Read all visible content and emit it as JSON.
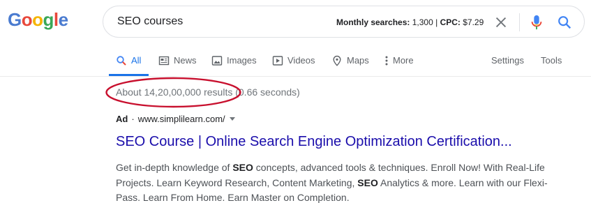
{
  "logo": {
    "letters": [
      "G",
      "o",
      "o",
      "g",
      "l",
      "e"
    ]
  },
  "search": {
    "query": "SEO courses",
    "metrics_label_1": "Monthly searches:",
    "metrics_value_1": "1,300",
    "metrics_sep": "|",
    "metrics_label_2": "CPC:",
    "metrics_value_2": "$7.29"
  },
  "tabs": [
    {
      "label": "All",
      "icon": "search-icon",
      "active": true
    },
    {
      "label": "News",
      "icon": "newspaper-icon"
    },
    {
      "label": "Images",
      "icon": "image-icon"
    },
    {
      "label": "Videos",
      "icon": "video-icon"
    },
    {
      "label": "Maps",
      "icon": "map-pin-icon"
    },
    {
      "label": "More",
      "icon": "more-vert-icon"
    }
  ],
  "tools": {
    "settings_label": "Settings",
    "tools_label": "Tools"
  },
  "results_stats": "About 14,20,00,000 results (0.66 seconds)",
  "ad": {
    "badge": "Ad",
    "dot": "·",
    "url": "www.simplilearn.com/",
    "title": "SEO Course | Online Search Engine Optimization Certification...",
    "desc": [
      {
        "t": "Get in-depth knowledge of "
      },
      {
        "t": "SEO",
        "b": true
      },
      {
        "t": " concepts, advanced tools & techniques. Enroll Now! With Real-Life Projects. Learn Keyword Research, Content Marketing, "
      },
      {
        "t": "SEO",
        "b": true
      },
      {
        "t": " Analytics & more. Learn with our Flexi-Pass. Learn From Home. Earn Master on Completion."
      }
    ]
  },
  "colors": {
    "accent": "#1a73e8",
    "link": "#1a0dab",
    "annotation": "#c8102e"
  }
}
